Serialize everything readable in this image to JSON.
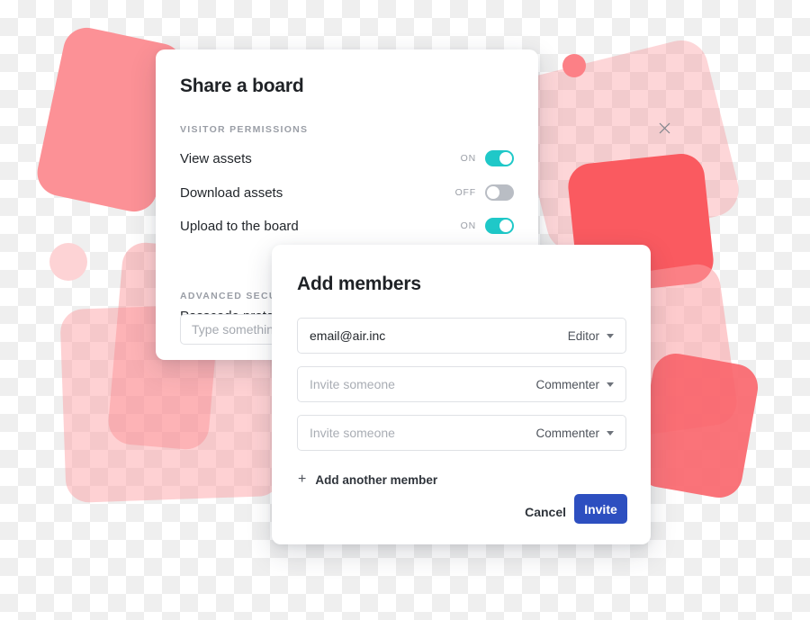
{
  "share_dialog": {
    "title": "Share a board",
    "close_icon": "close-icon",
    "visitor_permissions_label": "VISITOR PERMISSIONS",
    "permissions": [
      {
        "label": "View assets",
        "state": "ON",
        "on": true
      },
      {
        "label": "Download assets",
        "state": "OFF",
        "on": false
      },
      {
        "label": "Upload to the board",
        "state": "ON",
        "on": true
      }
    ],
    "advanced_security_label": "ADVANCED SECURITY",
    "passcode_label": "Passcode protection",
    "passcode_placeholder": "Type something"
  },
  "add_members_dialog": {
    "title": "Add members",
    "close_icon": "close-icon",
    "members": [
      {
        "email": "email@air.inc",
        "is_placeholder": false,
        "role": "Editor"
      },
      {
        "email": "Invite someone",
        "is_placeholder": true,
        "role": "Commenter"
      },
      {
        "email": "Invite someone",
        "is_placeholder": true,
        "role": "Commenter"
      }
    ],
    "add_another_label": "Add another member",
    "add_another_icon": "plus-icon",
    "cancel_label": "Cancel",
    "invite_label": "Invite"
  },
  "colors": {
    "toggle_on": "#1fc8c8",
    "toggle_off": "#b9bdc4",
    "invite_button": "#2d4fc0",
    "coral": "#fc9196",
    "coral_dark": "#fa5a60",
    "checker": "#efefef"
  }
}
